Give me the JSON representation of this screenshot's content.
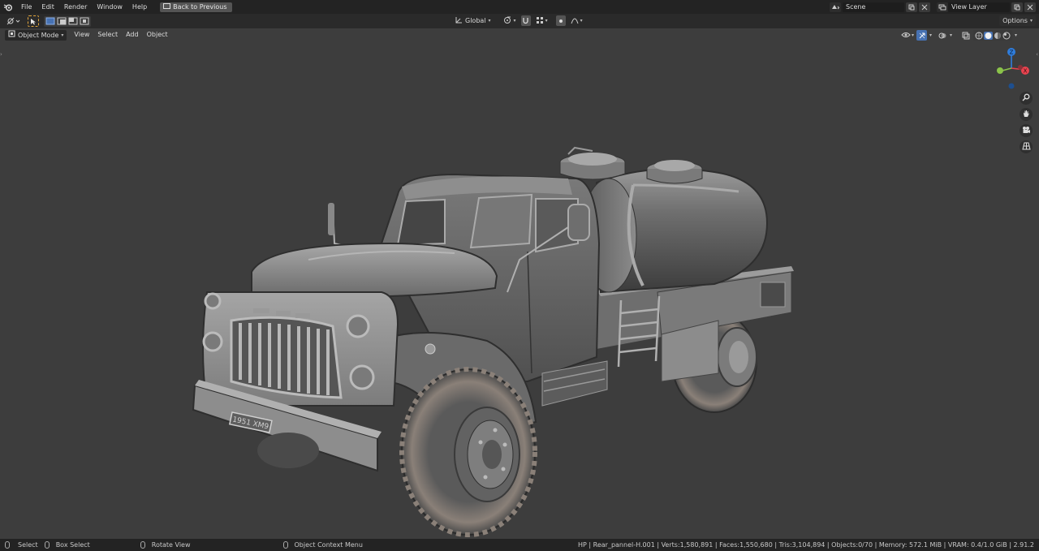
{
  "topbar": {
    "menus": [
      "File",
      "Edit",
      "Render",
      "Window",
      "Help"
    ],
    "back_label": "Back to Previous",
    "scene_value": "Scene",
    "view_layer_value": "View Layer"
  },
  "toolbar": {
    "orientation_label": "Global",
    "options_label": "Options"
  },
  "header": {
    "mode_label": "Object Mode",
    "menus": [
      "View",
      "Select",
      "Add",
      "Object"
    ]
  },
  "gizmo": {
    "z_label": "Z",
    "x_label": "X"
  },
  "plate": {
    "text": "1951 ХМ9"
  },
  "statusbar": {
    "select_label": "Select",
    "box_select_label": "Box Select",
    "rotate_label": "Rotate View",
    "context_menu_label": "Object Context Menu",
    "stats_text": "HP | Rear_pannel-H.001 | Verts:1,580,891 | Faces:1,550,680 | Tris:3,104,894 | Objects:0/70 | Memory: 572.1 MiB | VRAM: 0.4/1.0 GiB | 2.91.2"
  },
  "colors": {
    "topbar_bg": "#232323",
    "viewport_bg": "#3d3d3d",
    "accent_blue": "#4772b3",
    "axis_x": "#e8434f",
    "axis_y": "#8bc34a",
    "axis_z": "#2f7ddc"
  }
}
